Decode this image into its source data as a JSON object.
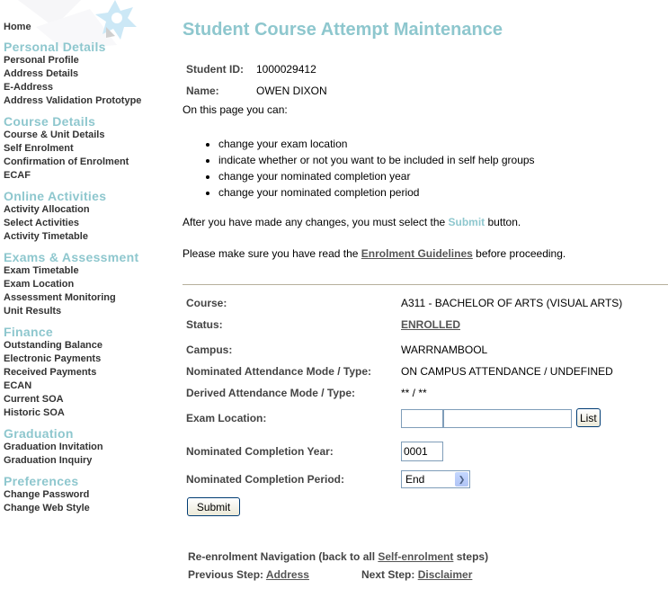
{
  "sidebar": {
    "home": "Home",
    "groups": [
      {
        "heading": "Personal Details",
        "items": [
          "Personal Profile",
          "Address Details",
          "E-Address",
          "Address Validation Prototype"
        ]
      },
      {
        "heading": "Course Details",
        "items": [
          "Course & Unit Details",
          "Self Enrolment",
          "Confirmation of Enrolment",
          "ECAF"
        ]
      },
      {
        "heading": "Online Activities",
        "items": [
          "Activity Allocation",
          "Select Activities",
          "Activity Timetable"
        ]
      },
      {
        "heading": "Exams & Assessment",
        "items": [
          "Exam Timetable",
          "Exam Location",
          "Assessment Monitoring",
          "Unit Results"
        ]
      },
      {
        "heading": "Finance",
        "items": [
          "Outstanding Balance",
          "Electronic Payments",
          "Received Payments",
          "ECAN",
          "Current SOA",
          "Historic SOA"
        ]
      },
      {
        "heading": "Graduation",
        "items": [
          "Graduation Invitation",
          "Graduation Inquiry"
        ]
      },
      {
        "heading": "Preferences",
        "items": [
          "Change Password",
          "Change Web Style"
        ]
      }
    ]
  },
  "page": {
    "title": "Student Course Attempt Maintenance",
    "student_id_label": "Student ID:",
    "student_id": "1000029412",
    "name_label": "Name:",
    "name": "OWEN DIXON",
    "intro": "On this page you can:",
    "bullets": [
      "change your exam location",
      "indicate whether or not you want to be included in self help groups",
      "change your nominated completion year",
      "change your nominated completion period"
    ],
    "para1_before": "After you have made any changes, you must select the ",
    "para1_accent": "Submit",
    "para1_after": " button.",
    "para2_before": "Please make sure you have read the ",
    "para2_link": "Enrolment Guidelines",
    "para2_after": " before proceeding."
  },
  "form": {
    "course_label": "Course:",
    "course": "A311 - BACHELOR OF ARTS (VISUAL ARTS)",
    "status_label": "Status:",
    "status": "ENROLLED",
    "campus_label": "Campus:",
    "campus": "WARRNAMBOOL",
    "nom_mode_label": "Nominated Attendance Mode / Type:",
    "nom_mode": "ON CAMPUS ATTENDANCE / UNDEFINED",
    "der_mode_label": "Derived Attendance Mode / Type:",
    "der_mode": "** / **",
    "exam_loc_label": "Exam Location:",
    "exam_loc_code": "",
    "exam_loc_name": "",
    "list_button": "List",
    "comp_year_label": "Nominated Completion Year:",
    "comp_year": "0001",
    "comp_period_label": "Nominated Completion Period:",
    "comp_period": "End",
    "submit_button": "Submit"
  },
  "navigation": {
    "line1_before": "Re-enrolment Navigation (back to all ",
    "line1_link": "Self-enrolment",
    "line1_after": " steps)",
    "prev_label": "Previous Step: ",
    "prev_link": "Address",
    "next_label": "Next Step: ",
    "next_link": "Disclaimer"
  },
  "colors": {
    "accent": "#8ec7ce",
    "nav_text": "#333333",
    "divider": "#b7b09c"
  }
}
